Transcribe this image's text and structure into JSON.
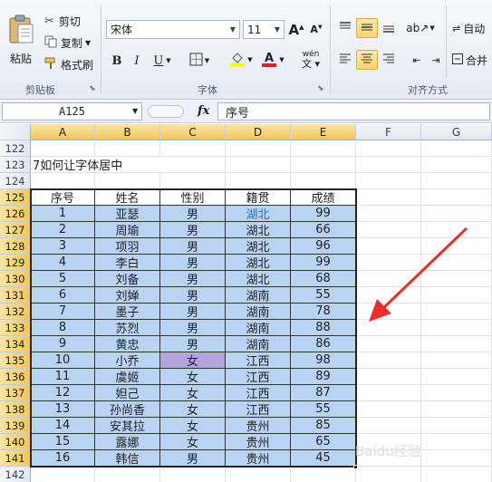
{
  "clipboard": {
    "paste_label": "粘贴",
    "cut_label": "剪切",
    "copy_label": "复制",
    "format_painter_label": "格式刷",
    "group_label": "剪贴板"
  },
  "font": {
    "font_name": "宋体",
    "font_size": "11",
    "bold_label": "B",
    "italic_label": "I",
    "underline_label": "U",
    "phonetic_label": "wén",
    "group_label": "字体",
    "font_color": "#e02020",
    "fill_color": "#ffff00"
  },
  "alignment": {
    "wrap_label": "自动",
    "merge_label": "合并",
    "group_label": "对齐方式"
  },
  "formula_bar": {
    "name_box": "A125",
    "fx_label": "fx",
    "formula": "序号"
  },
  "sheet": {
    "columns": [
      "A",
      "B",
      "C",
      "D",
      "E",
      "F",
      "G"
    ],
    "rows": [
      "122",
      "123",
      "124",
      "125",
      "126",
      "127",
      "128",
      "129",
      "130",
      "131",
      "132",
      "133",
      "134",
      "135",
      "136",
      "137",
      "138",
      "139",
      "140",
      "141",
      "142"
    ],
    "title_cell": "7如何让字体居中",
    "table_header": [
      "序号",
      "姓名",
      "性别",
      "籍贯",
      "成绩"
    ],
    "table_rows": [
      [
        "1",
        "亚瑟",
        "男",
        "湖北",
        "99"
      ],
      [
        "2",
        "周瑜",
        "男",
        "湖北",
        "66"
      ],
      [
        "3",
        "项羽",
        "男",
        "湖北",
        "96"
      ],
      [
        "4",
        "李白",
        "男",
        "湖北",
        "99"
      ],
      [
        "5",
        "刘备",
        "男",
        "湖北",
        "68"
      ],
      [
        "6",
        "刘婵",
        "男",
        "湖南",
        "55"
      ],
      [
        "7",
        "墨子",
        "男",
        "湖南",
        "78"
      ],
      [
        "8",
        "苏烈",
        "男",
        "湖南",
        "88"
      ],
      [
        "9",
        "黄忠",
        "男",
        "湖南",
        "86"
      ],
      [
        "10",
        "小乔",
        "女",
        "江西",
        "98"
      ],
      [
        "11",
        "虞姬",
        "女",
        "江西",
        "89"
      ],
      [
        "12",
        "妲己",
        "女",
        "江西",
        "87"
      ],
      [
        "13",
        "孙尚香",
        "女",
        "江西",
        "55"
      ],
      [
        "14",
        "安其拉",
        "女",
        "贵州",
        "85"
      ],
      [
        "15",
        "露娜",
        "女",
        "贵州",
        "65"
      ],
      [
        "16",
        "韩信",
        "男",
        "贵州",
        "45"
      ]
    ],
    "selection_fill": "#b9d4f2",
    "highlight_fill": "#b3a4dc",
    "arrow_color": "#e8302a"
  },
  "watermark": "Baidu经验"
}
